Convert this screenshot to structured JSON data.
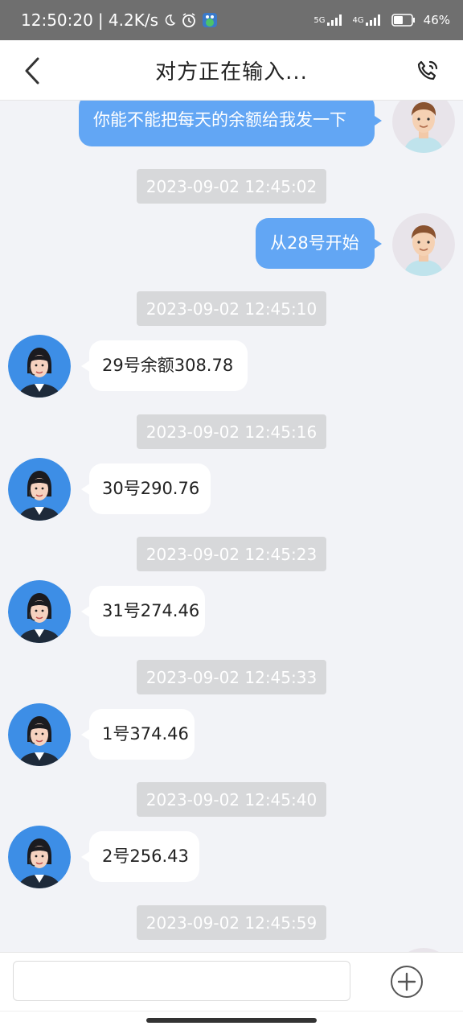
{
  "status_bar": {
    "time": "12:50:20",
    "speed": "| 4.2K/s",
    "network_5g": "5G",
    "network_4g": "4G",
    "battery": "46%"
  },
  "header": {
    "title": "对方正在输入..."
  },
  "messages": [
    {
      "type": "sent",
      "text": "你能不能把每天的余额给我发一下"
    },
    {
      "type": "time",
      "text": "2023-09-02 12:45:02"
    },
    {
      "type": "sent",
      "text": "从28号开始"
    },
    {
      "type": "time",
      "text": "2023-09-02 12:45:10"
    },
    {
      "type": "recv",
      "text": "29号余额308.78"
    },
    {
      "type": "time",
      "text": "2023-09-02 12:45:16"
    },
    {
      "type": "recv",
      "text": "30号290.76"
    },
    {
      "type": "time",
      "text": "2023-09-02 12:45:23"
    },
    {
      "type": "recv",
      "text": "31号274.46"
    },
    {
      "type": "time",
      "text": "2023-09-02 12:45:33"
    },
    {
      "type": "recv",
      "text": "1号374.46"
    },
    {
      "type": "time",
      "text": "2023-09-02 12:45:40"
    },
    {
      "type": "recv",
      "text": "2号256.43"
    },
    {
      "type": "time",
      "text": "2023-09-02 12:45:59"
    }
  ],
  "input": {
    "placeholder": ""
  },
  "colors": {
    "sent_bubble": "#62a6f4",
    "received_bubble": "#ffffff",
    "timestamp_bg": "#d7d8da",
    "status_bar": "#6f6f6f"
  }
}
